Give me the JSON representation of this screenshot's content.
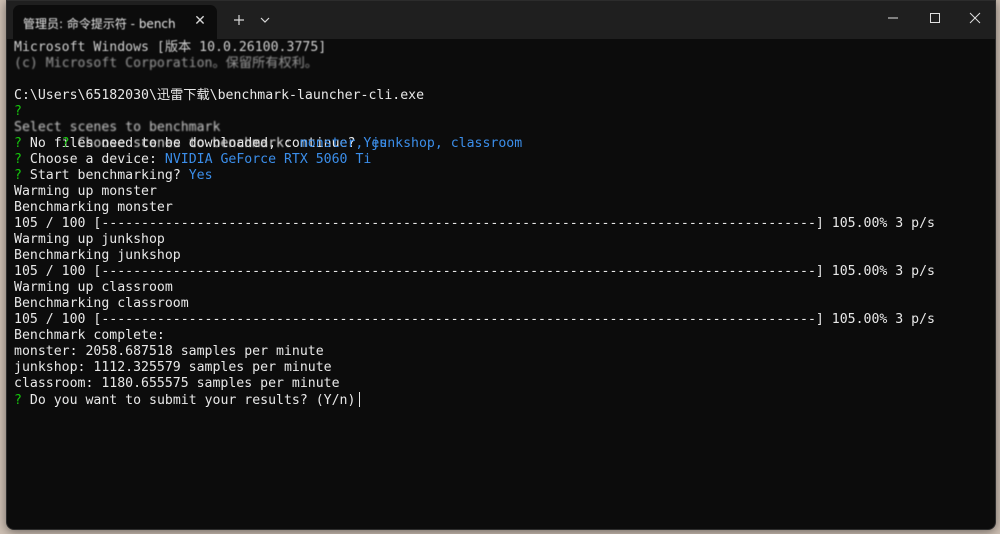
{
  "window": {
    "tab_title": "管理员: 命令提示符 - bench",
    "tab_close_icon": "close-icon",
    "new_tab_icon": "plus-icon",
    "dropdown_icon": "chevron-down-icon"
  },
  "console": {
    "header_line_1": "Microsoft Windows [版本 10.0.26100.3775]",
    "header_line_2": "(c) Microsoft Corporation。保留所有权利。",
    "prompt_line": "C:\\Users\\65182030\\迅雷下载\\benchmark-launcher-cli.exe",
    "q_mark": "?",
    "scenes_ghost": "Select scenes to benchmark",
    "scenes_label": "Choose scenes to benchmark: ",
    "scenes_answer": "monster, junkshop, classroom",
    "download_label": "No files need to be downloaded, continue? ",
    "download_answer": "Yes",
    "device_label": "Choose a device: ",
    "device_answer": "NVIDIA GeForce RTX 5060 Ti",
    "start_label": "Start benchmarking? ",
    "start_answer": "Yes",
    "warm_monster": "Warming up monster",
    "bench_monster": "Benchmarking monster",
    "progress_monster": "105 / 100 [------------------------------------------------------------------------------------------] 105.00% 3 p/s",
    "warm_junkshop": "Warming up junkshop",
    "bench_junkshop": "Benchmarking junkshop",
    "progress_junkshop": "105 / 100 [------------------------------------------------------------------------------------------] 105.00% 3 p/s",
    "warm_classroom": "Warming up classroom",
    "bench_classroom": "Benchmarking classroom",
    "progress_classroom": "105 / 100 [------------------------------------------------------------------------------------------] 105.00% 3 p/s",
    "complete": "Benchmark complete:",
    "result_monster": "monster: 2058.687518 samples per minute",
    "result_junkshop": "junkshop: 1112.325579 samples per minute",
    "result_classroom": "classroom: 1180.655575 samples per minute",
    "submit_label": "Do you want to submit your results? (Y/n)"
  },
  "colors": {
    "background": "#0c0c0c",
    "titlebar": "#1f1f1f",
    "question_mark": "#16c60c",
    "answer": "#3b8eea",
    "text": "#e8e8e8"
  }
}
